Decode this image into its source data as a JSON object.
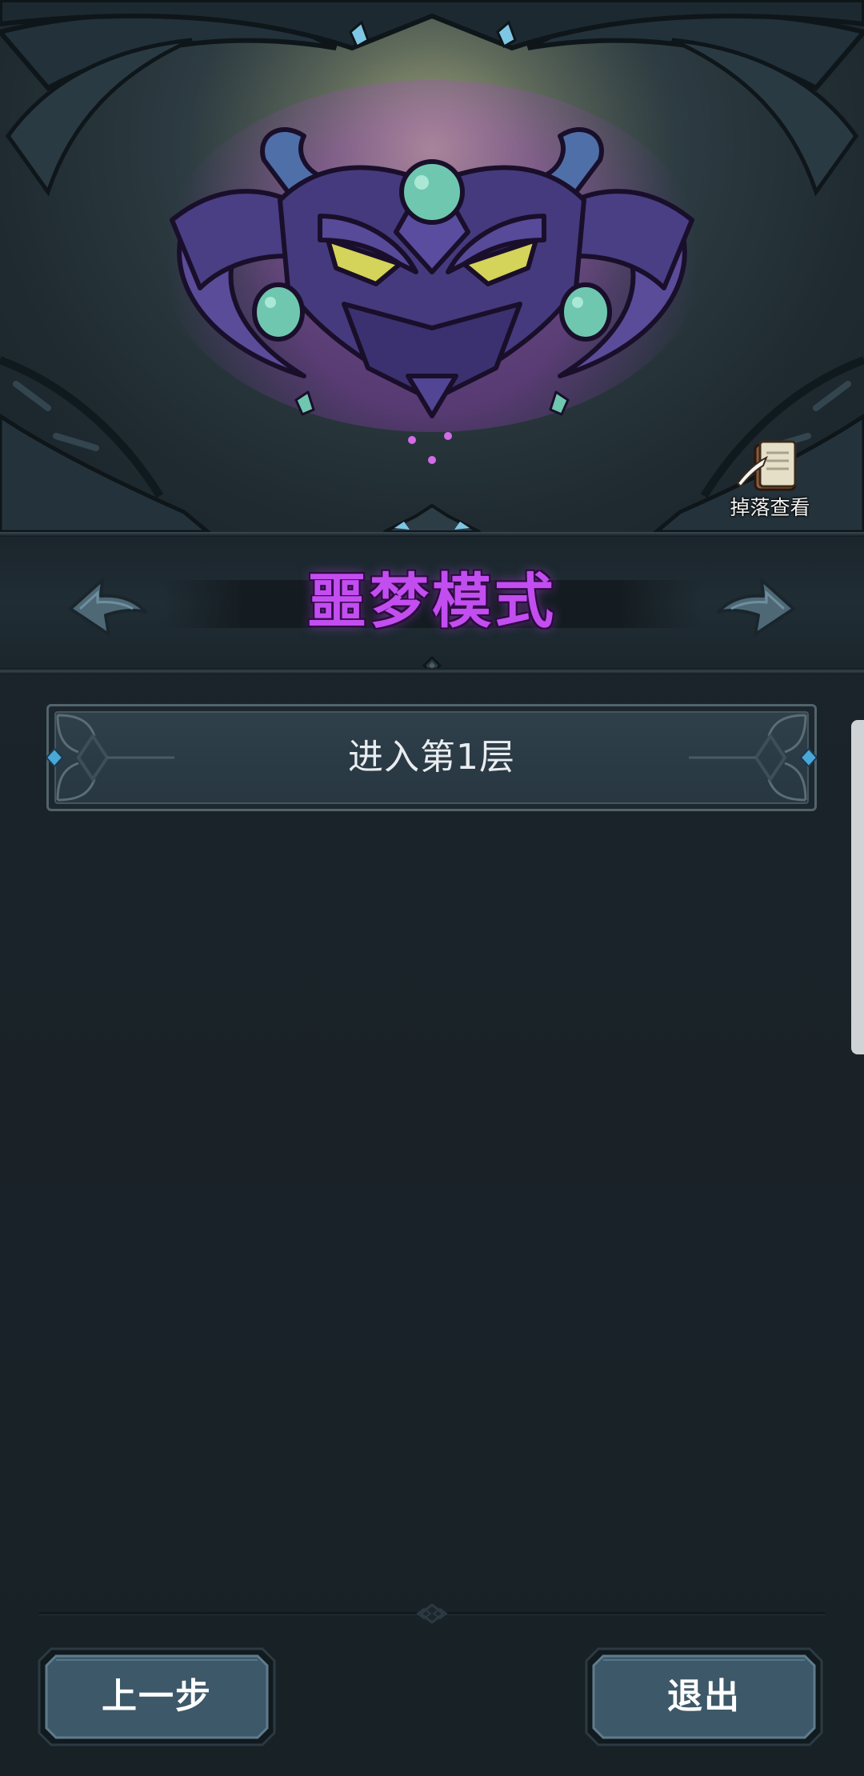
{
  "banner": {
    "drop_view_label": "掉落查看",
    "boss_icon": "nightmare-demon-mask"
  },
  "mode_selector": {
    "title": "噩梦模式",
    "title_color": "#c24ef0",
    "prev_icon": "curved-arrow-left-icon",
    "next_icon": "curved-arrow-right-icon"
  },
  "floors": [
    {
      "label": "进入第1层"
    }
  ],
  "footer": {
    "prev_label": "上一步",
    "exit_label": "退出"
  },
  "colors": {
    "background": "#1a2329",
    "button_fill": "#3d5868",
    "accent_gem": "#4aa8d8"
  }
}
